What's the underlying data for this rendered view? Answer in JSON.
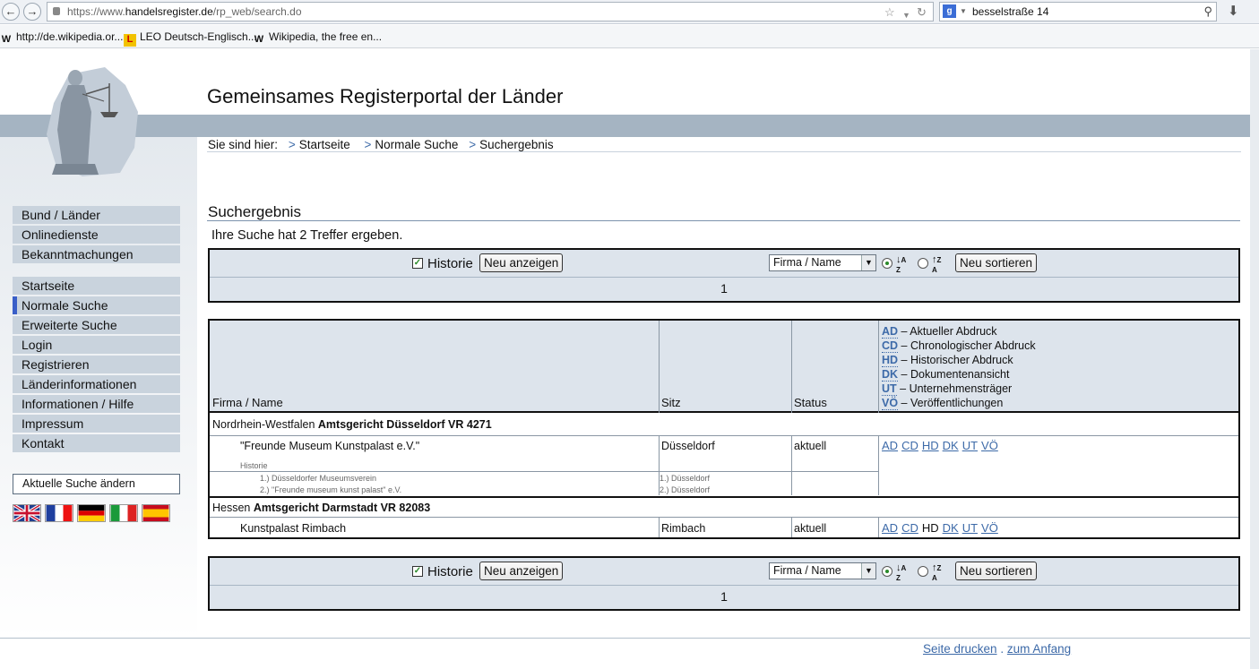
{
  "browser": {
    "url_prefix": "https://www.",
    "url_domain": "handelsregister.de",
    "url_path": "/rp_web/search.do",
    "search_engine_letter": "g",
    "search_query": "besselstraße 14",
    "bookmarks": [
      {
        "label": "http://de.wikipedia.or...",
        "icon": "W"
      },
      {
        "label": "LEO Deutsch-Englisch...",
        "icon": "L"
      },
      {
        "label": "Wikipedia, the free en...",
        "icon": "W"
      }
    ]
  },
  "site": {
    "title": "Gemeinsames Registerportal der Länder",
    "breadcrumb_label": "Sie sind hier:",
    "breadcrumb": [
      "Startseite",
      "Normale Suche",
      "Suchergebnis"
    ]
  },
  "sidebar": {
    "group1": [
      "Bund / Länder",
      "Onlinedienste",
      "Bekanntmachungen"
    ],
    "group2": [
      "Startseite",
      "Normale Suche",
      "Erweiterte Suche",
      "Login",
      "Registrieren",
      "Länderinformationen",
      "Informationen / Hilfe",
      "Impressum",
      "Kontakt"
    ],
    "active_item": "Normale Suche",
    "edit_search": "Aktuelle Suche ändern"
  },
  "results": {
    "title": "Suchergebnis",
    "count_text": "Ihre Suche hat 2 Treffer ergeben.",
    "controls": {
      "historie_label": "Historie",
      "historie_checked": true,
      "show_button": "Neu anzeigen",
      "sort_field": "Firma / Name",
      "sort_button": "Neu sortieren",
      "sort_direction": "ascending",
      "page": "1"
    },
    "headers": {
      "name": "Firma / Name",
      "seat": "Sitz",
      "status": "Status"
    },
    "legend": [
      {
        "code": "AD",
        "text": "– Aktueller Abdruck"
      },
      {
        "code": "CD",
        "text": "– Chronologischer Abdruck"
      },
      {
        "code": "HD",
        "text": "– Historischer Abdruck"
      },
      {
        "code": "DK",
        "text": "– Dokumentenansicht"
      },
      {
        "code": "UT",
        "text": "– Unternehmensträger"
      },
      {
        "code": "VÖ",
        "text": "– Veröffentlichungen"
      }
    ],
    "entries": [
      {
        "state": "Nordrhein-Westfalen",
        "court": "Amtsgericht Düsseldorf VR 4271",
        "name": "\"Freunde Museum Kunstpalast e.V.\"",
        "seat": "Düsseldorf",
        "status": "aktuell",
        "history_label": "Historie",
        "history_names": [
          "1.) Düsseldorfer Museumsverein",
          "2.) \"Freunde museum kunst palast\" e.V."
        ],
        "history_seats": [
          "1.) Düsseldorf",
          "2.) Düsseldorf"
        ],
        "links": [
          "AD",
          "CD",
          "HD",
          "DK",
          "UT",
          "VÖ"
        ]
      },
      {
        "state": "Hessen",
        "court": "Amtsgericht Darmstadt VR 82083",
        "name": "Kunstpalast Rimbach",
        "seat": "Rimbach",
        "status": "aktuell",
        "links": [
          "AD",
          "CD",
          "HD",
          "DK",
          "UT",
          "VÖ"
        ]
      }
    ]
  },
  "footer": {
    "print": "Seite drucken",
    "separator": ".",
    "top": "zum Anfang"
  },
  "colors": {
    "band": "#a5b4c2",
    "menu_bg": "#c9d3dd",
    "active_marker": "#3a5fc8",
    "link": "#3d6aa8",
    "table_header": "#dde4ec"
  }
}
